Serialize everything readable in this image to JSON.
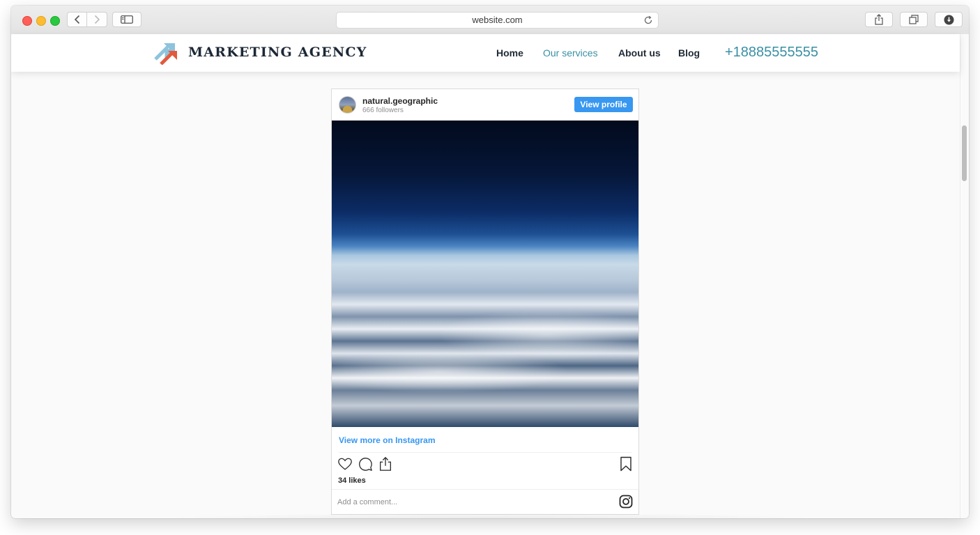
{
  "browser": {
    "url": "website.com"
  },
  "site": {
    "logo_text": "MARKETING AGENCY",
    "nav": {
      "home": "Home",
      "services": "Our services",
      "about": "About us",
      "blog": "Blog"
    },
    "phone": "+18885555555",
    "accent_color": "#3a8fa4"
  },
  "post": {
    "username": "natural.geographic",
    "followers": "666 followers",
    "view_profile": "View profile",
    "view_more": "View more on Instagram",
    "likes": "34 likes",
    "comment_placeholder": "Add a comment...",
    "button_color": "#3897f0"
  }
}
